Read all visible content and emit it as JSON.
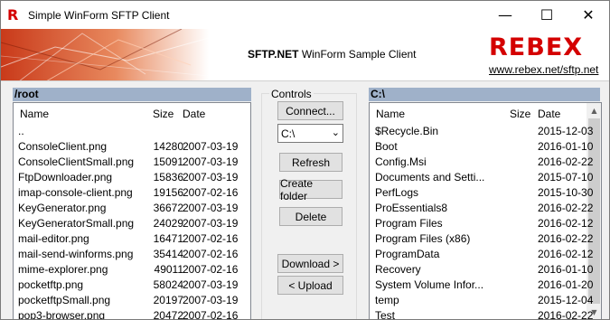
{
  "window": {
    "title": "Simple WinForm SFTP Client",
    "icon_letter": "R",
    "minimize_glyph": "—",
    "maximize_glyph": "☐",
    "close_glyph": "✕"
  },
  "banner": {
    "product": "SFTP.NET",
    "subtitle": "WinForm Sample Client",
    "logo_text": "REBEX",
    "link": "www.rebex.net/sftp.net",
    "accent_color": "#d40000"
  },
  "remote": {
    "path": "/root",
    "columns": [
      "Name",
      "Size",
      "Date"
    ],
    "rows": [
      {
        "name": "..",
        "size": "",
        "date": ""
      },
      {
        "name": "ConsoleClient.png",
        "size": "14280",
        "date": "2007-03-19"
      },
      {
        "name": "ConsoleClientSmall.png",
        "size": "15091",
        "date": "2007-03-19"
      },
      {
        "name": "FtpDownloader.png",
        "size": "15836",
        "date": "2007-03-19"
      },
      {
        "name": "imap-console-client.png",
        "size": "19156",
        "date": "2007-02-16"
      },
      {
        "name": "KeyGenerator.png",
        "size": "36672",
        "date": "2007-03-19"
      },
      {
        "name": "KeyGeneratorSmall.png",
        "size": "24029",
        "date": "2007-03-19"
      },
      {
        "name": "mail-editor.png",
        "size": "16471",
        "date": "2007-02-16"
      },
      {
        "name": "mail-send-winforms.png",
        "size": "35414",
        "date": "2007-02-16"
      },
      {
        "name": "mime-explorer.png",
        "size": "49011",
        "date": "2007-02-16"
      },
      {
        "name": "pocketftp.png",
        "size": "58024",
        "date": "2007-03-19"
      },
      {
        "name": "pocketftpSmall.png",
        "size": "20197",
        "date": "2007-03-19"
      },
      {
        "name": "pop3-browser.png",
        "size": "20472",
        "date": "2007-02-16"
      }
    ]
  },
  "controls": {
    "label": "Controls",
    "connect": "Connect...",
    "drive": "C:\\",
    "refresh": "Refresh",
    "create_folder": "Create folder",
    "delete": "Delete",
    "download": "Download >",
    "upload": "< Upload"
  },
  "local": {
    "path": "C:\\",
    "columns": [
      "Name",
      "Size",
      "Date"
    ],
    "rows": [
      {
        "name": "$Recycle.Bin",
        "size": "",
        "date": "2015-12-03"
      },
      {
        "name": "Boot",
        "size": "",
        "date": "2016-01-10"
      },
      {
        "name": "Config.Msi",
        "size": "",
        "date": "2016-02-22"
      },
      {
        "name": "Documents and Setti...",
        "size": "",
        "date": "2015-07-10"
      },
      {
        "name": "PerfLogs",
        "size": "",
        "date": "2015-10-30"
      },
      {
        "name": "ProEssentials8",
        "size": "",
        "date": "2016-02-22"
      },
      {
        "name": "Program Files",
        "size": "",
        "date": "2016-02-12"
      },
      {
        "name": "Program Files (x86)",
        "size": "",
        "date": "2016-02-22"
      },
      {
        "name": "ProgramData",
        "size": "",
        "date": "2016-02-12"
      },
      {
        "name": "Recovery",
        "size": "",
        "date": "2016-01-10"
      },
      {
        "name": "System Volume Infor...",
        "size": "",
        "date": "2016-01-20"
      },
      {
        "name": "temp",
        "size": "",
        "date": "2015-12-04"
      },
      {
        "name": "Test",
        "size": "",
        "date": "2016-02-22"
      }
    ]
  },
  "scrollbar": {
    "up": "▲",
    "down": "▼"
  }
}
